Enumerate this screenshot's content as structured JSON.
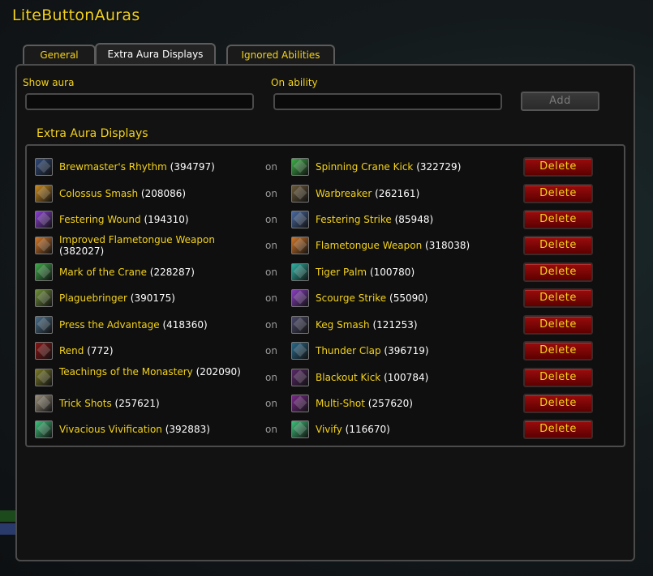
{
  "app": {
    "title": "LiteButtonAuras"
  },
  "tabs": [
    {
      "label": "General"
    },
    {
      "label": "Extra Aura Displays"
    },
    {
      "label": "Ignored Abilities"
    }
  ],
  "form": {
    "show_aura_label": "Show aura",
    "on_ability_label": "On ability",
    "show_aura_value": "",
    "on_ability_value": "",
    "add_label": "Add"
  },
  "section": {
    "title": "Extra Aura Displays"
  },
  "connector_label": "on",
  "delete_label": "Delete",
  "rows": [
    {
      "aura": "Brewmaster's Rhythm",
      "aura_id": "(394797)",
      "ability": "Spinning Crane Kick",
      "ability_id": "(322729)"
    },
    {
      "aura": "Colossus Smash",
      "aura_id": "(208086)",
      "ability": "Warbreaker",
      "ability_id": "(262161)"
    },
    {
      "aura": "Festering Wound",
      "aura_id": "(194310)",
      "ability": "Festering Strike",
      "ability_id": "(85948)"
    },
    {
      "aura": "Improved Flametongue Weapon",
      "aura_id": "(382027)",
      "ability": "Flametongue Weapon",
      "ability_id": "(318038)"
    },
    {
      "aura": "Mark of the Crane",
      "aura_id": "(228287)",
      "ability": "Tiger Palm",
      "ability_id": "(100780)"
    },
    {
      "aura": "Plaguebringer",
      "aura_id": "(390175)",
      "ability": "Scourge Strike",
      "ability_id": "(55090)"
    },
    {
      "aura": "Press the Advantage",
      "aura_id": "(418360)",
      "ability": "Keg Smash",
      "ability_id": "(121253)"
    },
    {
      "aura": "Rend",
      "aura_id": "(772)",
      "ability": "Thunder Clap",
      "ability_id": "(396719)"
    },
    {
      "aura": "Teachings of the Monastery",
      "aura_id": "(202090)",
      "ability": "Blackout Kick",
      "ability_id": "(100784)"
    },
    {
      "aura": "Trick Shots",
      "aura_id": "(257621)",
      "ability": "Multi-Shot",
      "ability_id": "(257620)"
    },
    {
      "aura": "Vivacious Vivification",
      "aura_id": "(392883)",
      "ability": "Vivify",
      "ability_id": "(116670)"
    }
  ],
  "icons": {
    "aura": [
      "#2f4a7a",
      "#c98a1e",
      "#8a3fd1",
      "#d1782a",
      "#3fa84a",
      "#6f8f3a",
      "#4a6f8a",
      "#8a1515",
      "#7a7a2a",
      "#9a8f7a",
      "#3fc07a"
    ],
    "ability": [
      "#3fb04a",
      "#6a5a3a",
      "#4a6aa0",
      "#d1782a",
      "#2fb0a0",
      "#8a3fc0",
      "#4a4a6a",
      "#2a6a8a",
      "#5a2a6a",
      "#7a2a8a",
      "#3fc07a"
    ]
  },
  "colors": {
    "accent_gold": "#f3d21c",
    "delete_red": "#8a0a0a",
    "id_white": "#ffffff"
  }
}
